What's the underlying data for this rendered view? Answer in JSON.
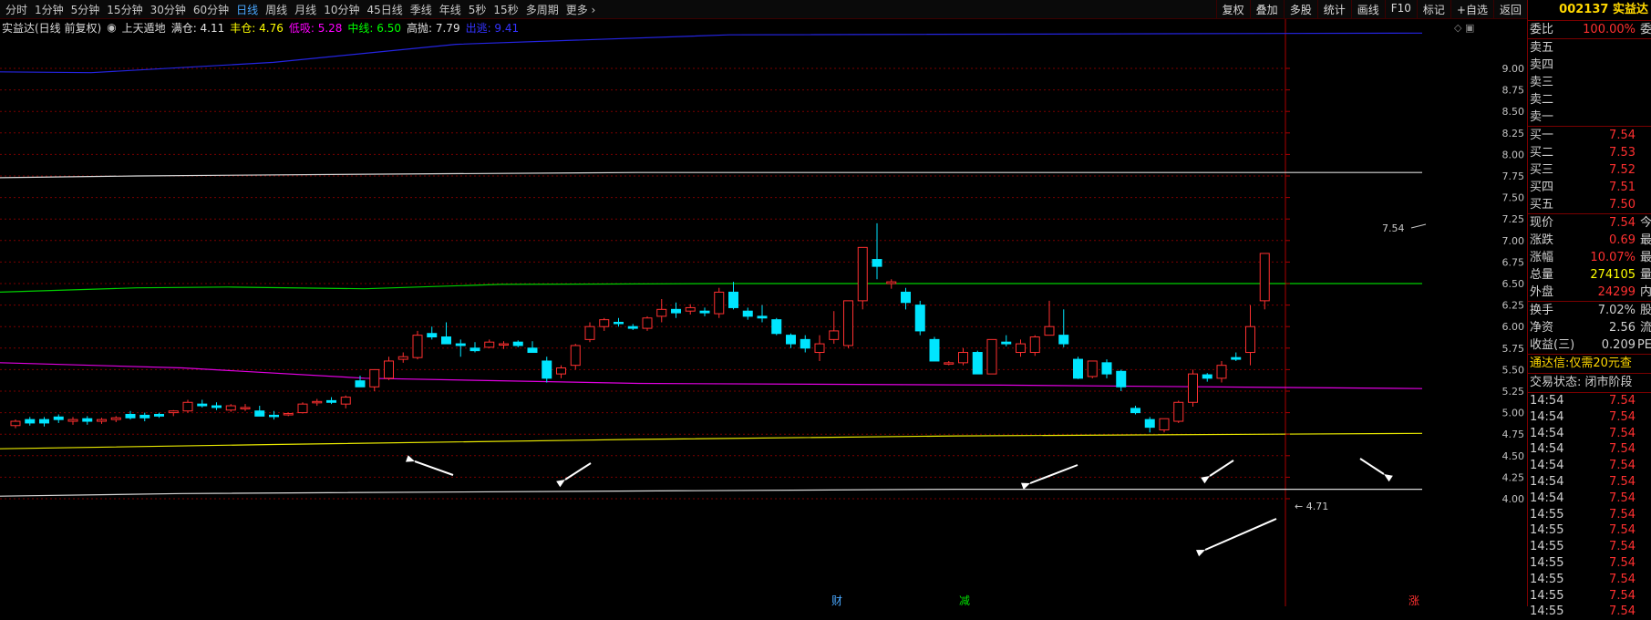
{
  "periods": [
    "分时",
    "1分钟",
    "5分钟",
    "15分钟",
    "30分钟",
    "60分钟",
    "日线",
    "周线",
    "月线",
    "10分钟",
    "45日线",
    "季线",
    "年线",
    "5秒",
    "15秒",
    "多周期",
    "更多 ›"
  ],
  "active_period": "日线",
  "tools": [
    "复权",
    "叠加",
    "多股",
    "统计",
    "画线",
    "F10",
    "标记",
    "+自选",
    "返回"
  ],
  "indicator": {
    "title": "实益达(日线 前复权)",
    "name": "上天遁地",
    "items": [
      {
        "label": "满仓: 4.11",
        "color": "#e0e0e0"
      },
      {
        "label": "丰仓: 4.76",
        "color": "#ffff00"
      },
      {
        "label": "低吸: 5.28",
        "color": "#ff00ff"
      },
      {
        "label": "中线: 6.50",
        "color": "#00ff00"
      },
      {
        "label": "高抛: 7.79",
        "color": "#e0e0e0"
      },
      {
        "label": "出逃: 9.41",
        "color": "#3333ff"
      }
    ]
  },
  "chart_data": {
    "type": "candlestick",
    "ylim": [
      3.92,
      9.47
    ],
    "yticks": [
      "9.00",
      "8.75",
      "8.50",
      "8.25",
      "8.00",
      "7.75",
      "7.50",
      "7.25",
      "7.00",
      "6.75",
      "6.50",
      "6.25",
      "6.00",
      "5.75",
      "5.50",
      "5.25",
      "5.00",
      "4.75",
      "4.50",
      "4.25",
      "4.00"
    ],
    "candles": [
      [
        4.85,
        4.92,
        4.82,
        4.9
      ],
      [
        4.92,
        4.95,
        4.85,
        4.88
      ],
      [
        4.92,
        4.95,
        4.84,
        4.88
      ],
      [
        4.95,
        4.98,
        4.88,
        4.92
      ],
      [
        4.9,
        4.95,
        4.86,
        4.92
      ],
      [
        4.93,
        4.96,
        4.86,
        4.9
      ],
      [
        4.9,
        4.94,
        4.87,
        4.92
      ],
      [
        4.92,
        4.96,
        4.89,
        4.94
      ],
      [
        4.98,
        5.02,
        4.92,
        4.94
      ],
      [
        4.97,
        5.0,
        4.9,
        4.94
      ],
      [
        4.98,
        5.0,
        4.94,
        4.96
      ],
      [
        5.0,
        5.03,
        4.96,
        5.02
      ],
      [
        5.02,
        5.15,
        5.0,
        5.12
      ],
      [
        5.1,
        5.15,
        5.06,
        5.08
      ],
      [
        5.08,
        5.12,
        5.03,
        5.06
      ],
      [
        5.03,
        5.1,
        5.01,
        5.08
      ],
      [
        5.05,
        5.1,
        5.02,
        5.06
      ],
      [
        5.02,
        5.08,
        4.96,
        4.96
      ],
      [
        4.97,
        5.02,
        4.92,
        4.96
      ],
      [
        4.98,
        5.0,
        4.96,
        4.99
      ],
      [
        5.0,
        5.12,
        4.99,
        5.1
      ],
      [
        5.12,
        5.16,
        5.08,
        5.13
      ],
      [
        5.14,
        5.18,
        5.1,
        5.12
      ],
      [
        5.1,
        5.2,
        5.05,
        5.18
      ],
      [
        5.37,
        5.43,
        5.3,
        5.3
      ],
      [
        5.3,
        5.45,
        5.25,
        5.5
      ],
      [
        5.4,
        5.65,
        5.38,
        5.6
      ],
      [
        5.62,
        5.7,
        5.58,
        5.65
      ],
      [
        5.64,
        5.95,
        5.62,
        5.9
      ],
      [
        5.92,
        6.0,
        5.85,
        5.88
      ],
      [
        5.88,
        6.05,
        5.8,
        5.8
      ],
      [
        5.8,
        5.85,
        5.65,
        5.78
      ],
      [
        5.75,
        5.82,
        5.7,
        5.72
      ],
      [
        5.76,
        5.85,
        5.75,
        5.82
      ],
      [
        5.8,
        5.83,
        5.74,
        5.8
      ],
      [
        5.82,
        5.84,
        5.76,
        5.78
      ],
      [
        5.75,
        5.83,
        5.7,
        5.7
      ],
      [
        5.6,
        5.65,
        5.35,
        5.4
      ],
      [
        5.45,
        5.55,
        5.4,
        5.52
      ],
      [
        5.55,
        5.8,
        5.5,
        5.78
      ],
      [
        5.85,
        6.05,
        5.82,
        6.0
      ],
      [
        6.0,
        6.1,
        5.95,
        6.08
      ],
      [
        6.05,
        6.1,
        6.0,
        6.04
      ],
      [
        6.0,
        6.03,
        5.96,
        5.98
      ],
      [
        5.98,
        6.12,
        5.95,
        6.1
      ],
      [
        6.12,
        6.32,
        6.05,
        6.2
      ],
      [
        6.2,
        6.28,
        6.1,
        6.16
      ],
      [
        6.18,
        6.26,
        6.14,
        6.22
      ],
      [
        6.18,
        6.22,
        6.12,
        6.16
      ],
      [
        6.15,
        6.45,
        6.1,
        6.4
      ],
      [
        6.4,
        6.52,
        6.2,
        6.22
      ],
      [
        6.18,
        6.22,
        6.08,
        6.12
      ],
      [
        6.12,
        6.25,
        6.05,
        6.1
      ],
      [
        6.08,
        6.1,
        5.9,
        5.92
      ],
      [
        5.9,
        5.92,
        5.75,
        5.8
      ],
      [
        5.85,
        5.9,
        5.7,
        5.75
      ],
      [
        5.7,
        5.9,
        5.6,
        5.8
      ],
      [
        5.85,
        6.18,
        5.8,
        5.95
      ],
      [
        5.78,
        5.95,
        5.75,
        6.3
      ],
      [
        6.3,
        6.92,
        6.2,
        6.92
      ],
      [
        6.78,
        7.2,
        6.55,
        6.7
      ],
      [
        6.5,
        6.55,
        6.44,
        6.52
      ],
      [
        6.4,
        6.45,
        6.2,
        6.28
      ],
      [
        6.25,
        6.3,
        5.9,
        5.95
      ],
      [
        5.85,
        5.88,
        5.6,
        5.6
      ],
      [
        5.58,
        5.6,
        5.55,
        5.58
      ],
      [
        5.58,
        5.75,
        5.55,
        5.7
      ],
      [
        5.7,
        5.72,
        5.45,
        5.45
      ],
      [
        5.45,
        5.85,
        5.45,
        5.85
      ],
      [
        5.82,
        5.9,
        5.77,
        5.8
      ],
      [
        5.7,
        5.85,
        5.65,
        5.8
      ],
      [
        5.7,
        5.9,
        5.66,
        5.88
      ],
      [
        5.9,
        6.3,
        5.9,
        6.0
      ],
      [
        5.9,
        6.2,
        5.76,
        5.8
      ],
      [
        5.62,
        5.65,
        5.39,
        5.4
      ],
      [
        5.42,
        5.6,
        5.4,
        5.6
      ],
      [
        5.58,
        5.62,
        5.4,
        5.45
      ],
      [
        5.48,
        5.5,
        5.25,
        5.3
      ],
      [
        5.05,
        5.08,
        4.98,
        5.0
      ],
      [
        4.92,
        4.95,
        4.77,
        4.83
      ],
      [
        4.8,
        4.92,
        4.77,
        4.93
      ],
      [
        4.9,
        5.14,
        4.88,
        5.12
      ],
      [
        5.12,
        5.5,
        5.07,
        5.45
      ],
      [
        5.44,
        5.46,
        5.36,
        5.4
      ],
      [
        5.4,
        5.6,
        5.35,
        5.55
      ],
      [
        5.64,
        5.7,
        5.6,
        5.62
      ],
      [
        5.7,
        6.25,
        5.55,
        6.0
      ],
      [
        6.3,
        6.85,
        6.2,
        6.85
      ]
    ],
    "levels": [
      {
        "name": "满仓",
        "value": 4.11,
        "color": "#d8d8d8"
      },
      {
        "name": "丰仓",
        "value": 4.76,
        "color": "#e8e800"
      },
      {
        "name": "低吸",
        "value": 5.28,
        "color": "#e000e0"
      },
      {
        "name": "中线",
        "value": 6.5,
        "color": "#00d000"
      },
      {
        "name": "高抛",
        "value": 7.79,
        "color": "#d8d8d8"
      },
      {
        "name": "出逃",
        "value": 9.41,
        "color": "#2424e0"
      }
    ],
    "annotations": {
      "price_marker": "7.54",
      "low_marker": "← 4.71",
      "bottom_labels": [
        {
          "text": "财",
          "color": "#4aa8ff"
        },
        {
          "text": "减",
          "color": "#00e000"
        },
        {
          "text": "涨",
          "color": "#ff3030"
        }
      ]
    }
  },
  "stock": {
    "code": "002137",
    "name": "实益达"
  },
  "order_book": {
    "wei_label": "委比",
    "wei_value": "100.00%",
    "wei_right": "委",
    "asks": [
      {
        "label": "卖五",
        "price": ""
      },
      {
        "label": "卖四",
        "price": ""
      },
      {
        "label": "卖三",
        "price": ""
      },
      {
        "label": "卖二",
        "price": ""
      },
      {
        "label": "卖一",
        "price": ""
      }
    ],
    "bids": [
      {
        "label": "买一",
        "price": "7.54"
      },
      {
        "label": "买二",
        "price": "7.53"
      },
      {
        "label": "买三",
        "price": "7.52"
      },
      {
        "label": "买四",
        "price": "7.51"
      },
      {
        "label": "买五",
        "price": "7.50"
      }
    ]
  },
  "quote": [
    {
      "label": "现价",
      "value": "7.54",
      "right": "今",
      "color": "#ff3030"
    },
    {
      "label": "涨跌",
      "value": "0.69",
      "right": "最",
      "color": "#ff3030"
    },
    {
      "label": "涨幅",
      "value": "10.07%",
      "right": "最",
      "color": "#ff3030"
    },
    {
      "label": "总量",
      "value": "274105",
      "right": "量",
      "color": "#ffff00"
    },
    {
      "label": "外盘",
      "value": "24299",
      "right": "内",
      "color": "#ff3030"
    }
  ],
  "fundamentals": [
    {
      "label": "换手",
      "value": "7.02%",
      "right": "股",
      "color": "#d0d0d0"
    },
    {
      "label": "净资",
      "value": "2.56",
      "right": "流",
      "color": "#d0d0d0"
    },
    {
      "label": "收益(三)",
      "value": "0.209",
      "right": "PE",
      "color": "#d0d0d0"
    }
  ],
  "notice": "通达信:仅需20元查",
  "status": "交易状态: 闭市阶段",
  "ticks": [
    {
      "time": "14:54",
      "price": "7.54"
    },
    {
      "time": "14:54",
      "price": "7.54"
    },
    {
      "time": "14:54",
      "price": "7.54"
    },
    {
      "time": "14:54",
      "price": "7.54"
    },
    {
      "time": "14:54",
      "price": "7.54"
    },
    {
      "time": "14:54",
      "price": "7.54"
    },
    {
      "time": "14:54",
      "price": "7.54"
    },
    {
      "time": "14:55",
      "price": "7.54"
    },
    {
      "time": "14:55",
      "price": "7.54"
    },
    {
      "time": "14:55",
      "price": "7.54"
    },
    {
      "time": "14:55",
      "price": "7.54"
    },
    {
      "time": "14:55",
      "price": "7.54"
    },
    {
      "time": "14:55",
      "price": "7.54"
    },
    {
      "time": "14:55",
      "price": "7.54"
    }
  ],
  "colors": {
    "up": "#ff3030",
    "down": "#00e5ff",
    "grid": "#7a0000",
    "axis": "#aa0000"
  }
}
